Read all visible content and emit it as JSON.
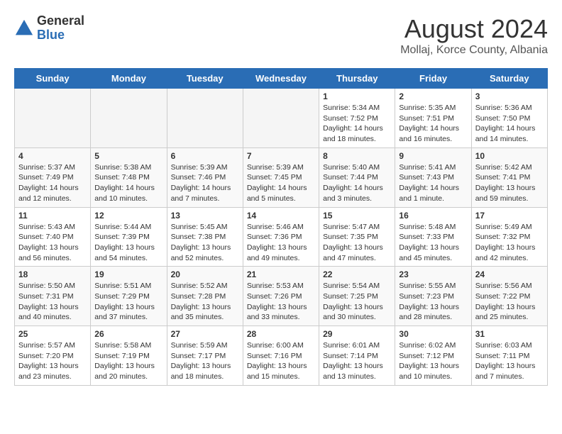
{
  "header": {
    "logo_general": "General",
    "logo_blue": "Blue",
    "title": "August 2024",
    "subtitle": "Mollaj, Korce County, Albania"
  },
  "days_of_week": [
    "Sunday",
    "Monday",
    "Tuesday",
    "Wednesday",
    "Thursday",
    "Friday",
    "Saturday"
  ],
  "weeks": [
    [
      {
        "day": "",
        "info": ""
      },
      {
        "day": "",
        "info": ""
      },
      {
        "day": "",
        "info": ""
      },
      {
        "day": "",
        "info": ""
      },
      {
        "day": "1",
        "info": "Sunrise: 5:34 AM\nSunset: 7:52 PM\nDaylight: 14 hours\nand 18 minutes."
      },
      {
        "day": "2",
        "info": "Sunrise: 5:35 AM\nSunset: 7:51 PM\nDaylight: 14 hours\nand 16 minutes."
      },
      {
        "day": "3",
        "info": "Sunrise: 5:36 AM\nSunset: 7:50 PM\nDaylight: 14 hours\nand 14 minutes."
      }
    ],
    [
      {
        "day": "4",
        "info": "Sunrise: 5:37 AM\nSunset: 7:49 PM\nDaylight: 14 hours\nand 12 minutes."
      },
      {
        "day": "5",
        "info": "Sunrise: 5:38 AM\nSunset: 7:48 PM\nDaylight: 14 hours\nand 10 minutes."
      },
      {
        "day": "6",
        "info": "Sunrise: 5:39 AM\nSunset: 7:46 PM\nDaylight: 14 hours\nand 7 minutes."
      },
      {
        "day": "7",
        "info": "Sunrise: 5:39 AM\nSunset: 7:45 PM\nDaylight: 14 hours\nand 5 minutes."
      },
      {
        "day": "8",
        "info": "Sunrise: 5:40 AM\nSunset: 7:44 PM\nDaylight: 14 hours\nand 3 minutes."
      },
      {
        "day": "9",
        "info": "Sunrise: 5:41 AM\nSunset: 7:43 PM\nDaylight: 14 hours\nand 1 minute."
      },
      {
        "day": "10",
        "info": "Sunrise: 5:42 AM\nSunset: 7:41 PM\nDaylight: 13 hours\nand 59 minutes."
      }
    ],
    [
      {
        "day": "11",
        "info": "Sunrise: 5:43 AM\nSunset: 7:40 PM\nDaylight: 13 hours\nand 56 minutes."
      },
      {
        "day": "12",
        "info": "Sunrise: 5:44 AM\nSunset: 7:39 PM\nDaylight: 13 hours\nand 54 minutes."
      },
      {
        "day": "13",
        "info": "Sunrise: 5:45 AM\nSunset: 7:38 PM\nDaylight: 13 hours\nand 52 minutes."
      },
      {
        "day": "14",
        "info": "Sunrise: 5:46 AM\nSunset: 7:36 PM\nDaylight: 13 hours\nand 49 minutes."
      },
      {
        "day": "15",
        "info": "Sunrise: 5:47 AM\nSunset: 7:35 PM\nDaylight: 13 hours\nand 47 minutes."
      },
      {
        "day": "16",
        "info": "Sunrise: 5:48 AM\nSunset: 7:33 PM\nDaylight: 13 hours\nand 45 minutes."
      },
      {
        "day": "17",
        "info": "Sunrise: 5:49 AM\nSunset: 7:32 PM\nDaylight: 13 hours\nand 42 minutes."
      }
    ],
    [
      {
        "day": "18",
        "info": "Sunrise: 5:50 AM\nSunset: 7:31 PM\nDaylight: 13 hours\nand 40 minutes."
      },
      {
        "day": "19",
        "info": "Sunrise: 5:51 AM\nSunset: 7:29 PM\nDaylight: 13 hours\nand 37 minutes."
      },
      {
        "day": "20",
        "info": "Sunrise: 5:52 AM\nSunset: 7:28 PM\nDaylight: 13 hours\nand 35 minutes."
      },
      {
        "day": "21",
        "info": "Sunrise: 5:53 AM\nSunset: 7:26 PM\nDaylight: 13 hours\nand 33 minutes."
      },
      {
        "day": "22",
        "info": "Sunrise: 5:54 AM\nSunset: 7:25 PM\nDaylight: 13 hours\nand 30 minutes."
      },
      {
        "day": "23",
        "info": "Sunrise: 5:55 AM\nSunset: 7:23 PM\nDaylight: 13 hours\nand 28 minutes."
      },
      {
        "day": "24",
        "info": "Sunrise: 5:56 AM\nSunset: 7:22 PM\nDaylight: 13 hours\nand 25 minutes."
      }
    ],
    [
      {
        "day": "25",
        "info": "Sunrise: 5:57 AM\nSunset: 7:20 PM\nDaylight: 13 hours\nand 23 minutes."
      },
      {
        "day": "26",
        "info": "Sunrise: 5:58 AM\nSunset: 7:19 PM\nDaylight: 13 hours\nand 20 minutes."
      },
      {
        "day": "27",
        "info": "Sunrise: 5:59 AM\nSunset: 7:17 PM\nDaylight: 13 hours\nand 18 minutes."
      },
      {
        "day": "28",
        "info": "Sunrise: 6:00 AM\nSunset: 7:16 PM\nDaylight: 13 hours\nand 15 minutes."
      },
      {
        "day": "29",
        "info": "Sunrise: 6:01 AM\nSunset: 7:14 PM\nDaylight: 13 hours\nand 13 minutes."
      },
      {
        "day": "30",
        "info": "Sunrise: 6:02 AM\nSunset: 7:12 PM\nDaylight: 13 hours\nand 10 minutes."
      },
      {
        "day": "31",
        "info": "Sunrise: 6:03 AM\nSunset: 7:11 PM\nDaylight: 13 hours\nand 7 minutes."
      }
    ]
  ]
}
